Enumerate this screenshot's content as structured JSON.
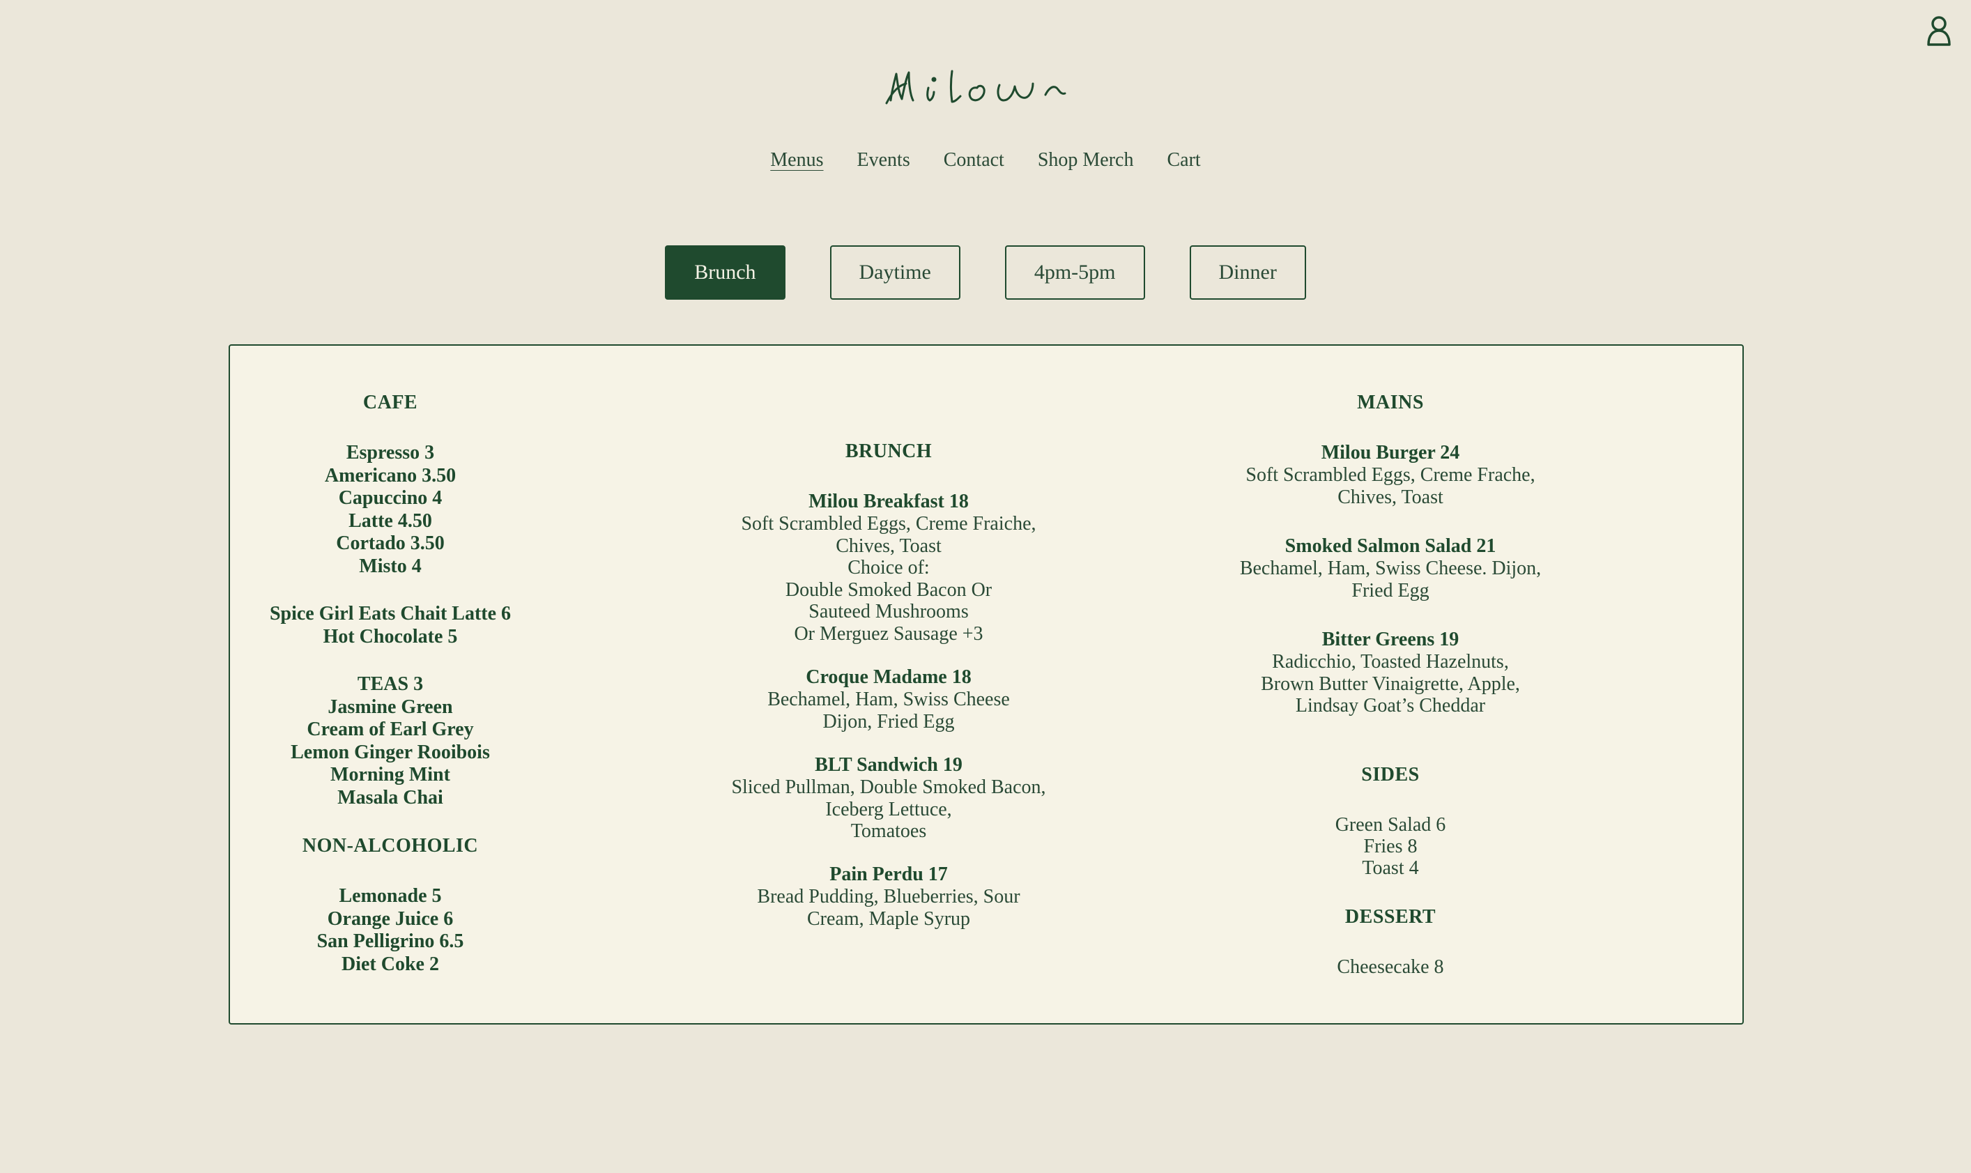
{
  "header": {
    "logo_text": "Milou",
    "account_icon": "user-icon"
  },
  "nav": {
    "items": [
      {
        "label": "Menus",
        "active": true
      },
      {
        "label": "Events"
      },
      {
        "label": "Contact"
      },
      {
        "label": "Shop Merch"
      },
      {
        "label": "Cart"
      }
    ]
  },
  "tabs": [
    {
      "label": "Brunch",
      "active": true
    },
    {
      "label": "Daytime"
    },
    {
      "label": "4pm-5pm"
    },
    {
      "label": "Dinner"
    }
  ],
  "colors": {
    "background": "#ebe7da",
    "card": "#f6f3e6",
    "accent": "#1f4a2e"
  },
  "menu": {
    "cafe": {
      "heading": "CAFE",
      "coffee": [
        "Espresso 3",
        "Americano 3.50",
        "Capuccino 4",
        "Latte 4.50",
        "Cortado 3.50",
        "Misto 4"
      ],
      "specials": [
        "Spice Girl Eats Chait Latte 6",
        "Hot Chocolate 5"
      ],
      "teas": [
        "TEAS 3",
        "Jasmine Green",
        "Cream of Earl Grey",
        "Lemon Ginger Rooibois",
        "Morning Mint",
        "Masala Chai"
      ],
      "non_alc_heading": "NON-ALCOHOLIC",
      "non_alc": [
        "Lemonade 5",
        "Orange Juice 6",
        "San Pelligrino 6.5",
        "Diet Coke 2"
      ]
    },
    "brunch": {
      "heading": "BRUNCH",
      "items": [
        {
          "name": "Milou Breakfast 18",
          "desc": [
            "Soft Scrambled Eggs, Creme Fraiche,",
            "Chives, Toast",
            "Choice of:",
            "Double Smoked Bacon Or",
            "Sauteed Mushrooms",
            "Or Merguez Sausage +3"
          ]
        },
        {
          "name": "Croque Madame 18",
          "desc": [
            "Bechamel, Ham, Swiss Cheese",
            "Dijon, Fried Egg"
          ]
        },
        {
          "name": "BLT Sandwich 19",
          "desc": [
            "Sliced Pullman, Double Smoked Bacon,",
            "Iceberg Lettuce,",
            "Tomatoes"
          ]
        },
        {
          "name": "Pain Perdu 17",
          "desc": [
            "Bread Pudding, Blueberries, Sour",
            "Cream, Maple Syrup"
          ]
        }
      ]
    },
    "mains": {
      "heading": "MAINS",
      "items": [
        {
          "name": "Milou Burger 24",
          "desc": [
            "Soft Scrambled Eggs, Creme Frache,",
            "Chives, Toast"
          ]
        },
        {
          "name": "Smoked Salmon Salad 21",
          "desc": [
            "Bechamel, Ham, Swiss Cheese. Dijon,",
            "Fried Egg"
          ]
        },
        {
          "name": "Bitter Greens 19",
          "desc": [
            "Radicchio, Toasted Hazelnuts,",
            "Brown Butter Vinaigrette, Apple,",
            "Lindsay Goat’s Cheddar"
          ]
        }
      ]
    },
    "sides": {
      "heading": "SIDES",
      "items": [
        "Green Salad 6",
        "Fries 8",
        "Toast 4"
      ]
    },
    "dessert": {
      "heading": "DESSERT",
      "items": [
        "Cheesecake 8"
      ]
    }
  }
}
